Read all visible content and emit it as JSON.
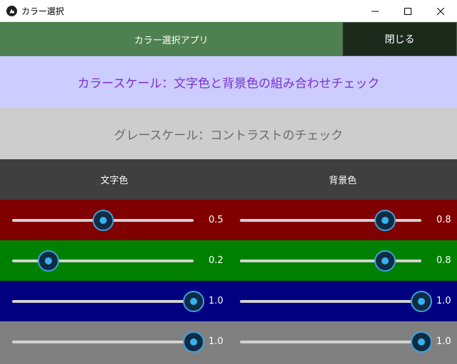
{
  "window": {
    "title": "カラー選択",
    "controls": {
      "minimize": "minimize",
      "maximize": "maximize",
      "close": "close"
    }
  },
  "topbar": {
    "app_title": "カラー選択アプリ",
    "close_label": "閉じる"
  },
  "color_banner": {
    "text": "カラースケール：文字色と背景色の組み合わせチェック",
    "background": "#ccccff",
    "text_color": "#7a2fd0"
  },
  "gray_banner": {
    "text": "グレースケール：コントラストのチェック",
    "background": "#cdcdcd",
    "text_color": "#6a6a6a"
  },
  "columns": {
    "text_color_label": "文字色",
    "background_color_label": "背景色"
  },
  "rows": [
    {
      "channel": "red",
      "row_color": "#800000",
      "text_value": 0.5,
      "text_label": "0.5",
      "bg_value": 0.8,
      "bg_label": "0.8"
    },
    {
      "channel": "green",
      "row_color": "#008000",
      "text_value": 0.2,
      "text_label": "0.2",
      "bg_value": 0.8,
      "bg_label": "0.8"
    },
    {
      "channel": "blue",
      "row_color": "#000080",
      "text_value": 1.0,
      "text_label": "1.0",
      "bg_value": 1.0,
      "bg_label": "1.0"
    },
    {
      "channel": "gray",
      "row_color": "#808080",
      "text_value": 1.0,
      "text_label": "1.0",
      "bg_value": 1.0,
      "bg_label": "1.0"
    }
  ],
  "colors": {
    "topbar_button": "#4f8150",
    "close_button": "#1b2a1b",
    "header_row": "#3f3f3f",
    "slider_knob_accent": "#39b1ee"
  }
}
